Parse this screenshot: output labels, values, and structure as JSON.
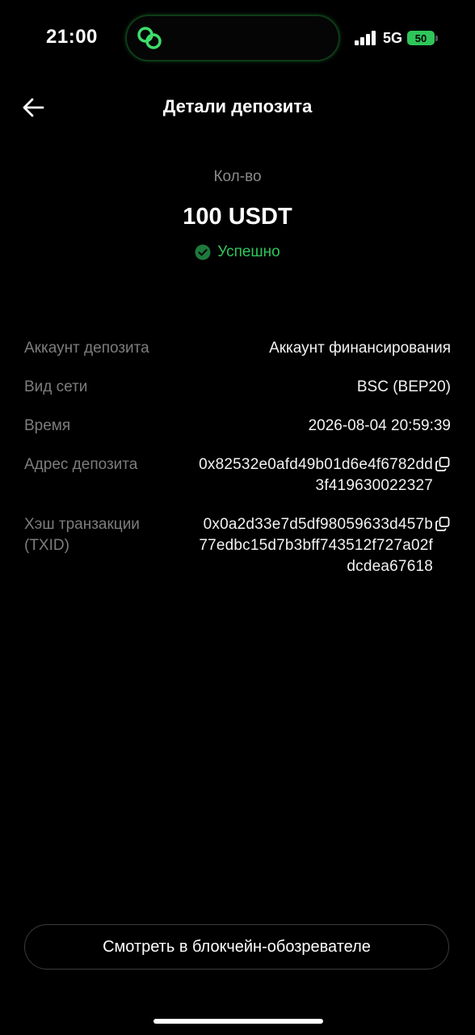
{
  "status_bar": {
    "time": "21:00",
    "network": "5G",
    "battery": "50"
  },
  "header": {
    "title": "Детали депозита"
  },
  "amount": {
    "label": "Кол-во",
    "value": "100 USDT",
    "status": "Успешно",
    "status_color": "#2ec65a"
  },
  "details": {
    "deposit_account_label": "Аккаунт депозита",
    "deposit_account_value": "Аккаунт финансирования",
    "network_label": "Вид сети",
    "network_value": "BSC (BEP20)",
    "time_label": "Время",
    "time_value": "2026-08-04 20:59:39",
    "address_label": "Адрес депозита",
    "address_value": "0x82532e0afd49b01d6e4f6782dd3f419630022327",
    "txid_label_line1": "Хэш транзакции",
    "txid_label_line2": "(TXID)",
    "txid_value": "0x0a2d33e7d5df98059633d457b77edbc15d7b3bff743512f727a02fdcdea67618"
  },
  "actions": {
    "explorer_button": "Смотреть в блокчейн-обозревателе"
  },
  "icons": {
    "back": "arrow-left-icon",
    "copy": "copy-icon",
    "success": "check-circle-icon"
  }
}
